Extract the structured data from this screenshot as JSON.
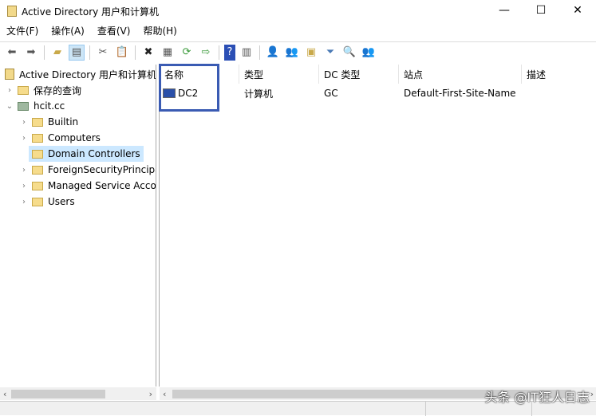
{
  "window": {
    "title": "Active Directory 用户和计算机",
    "minimize": "—",
    "maximize": "☐",
    "close": "✕"
  },
  "menu": [
    "文件(F)",
    "操作(A)",
    "查看(V)",
    "帮助(H)"
  ],
  "tree": {
    "root": "Active Directory 用户和计算机",
    "saved_queries": "保存的查询",
    "domain": "hcit.cc",
    "children": [
      "Builtin",
      "Computers",
      "Domain Controllers",
      "ForeignSecurityPrincipals",
      "Managed Service Accounts",
      "Users"
    ],
    "selected": "Domain Controllers"
  },
  "list": {
    "columns": [
      "名称",
      "类型",
      "DC 类型",
      "站点",
      "描述"
    ],
    "rows": [
      {
        "name": "DC2",
        "type": "计算机",
        "dc_type": "GC",
        "site": "Default-First-Site-Name",
        "desc": ""
      }
    ]
  },
  "watermark": "头条 @IT狂人日志"
}
